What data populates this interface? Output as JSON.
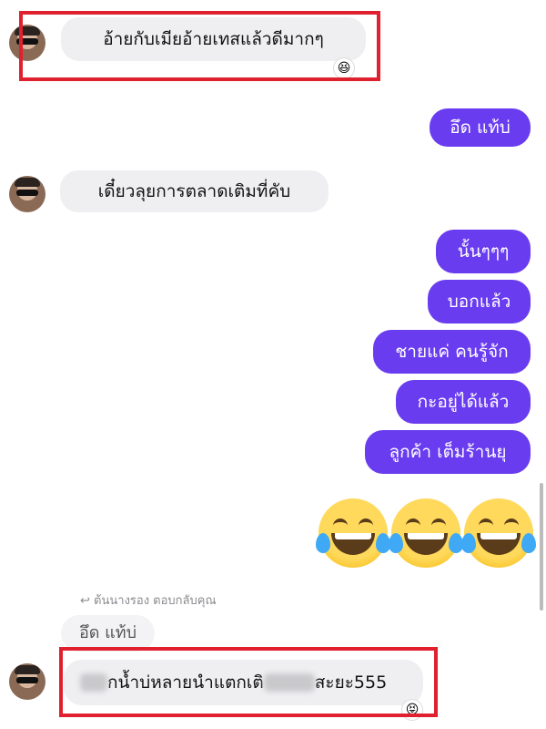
{
  "messages": {
    "m1": "อ้ายกับเมียอ้ายเทสแล้วดีมากๆ",
    "m2": "อึด แท้บ่",
    "m3": "เดี๋ยวลุยการตลาดเติมที่คับ",
    "m4": "นั้นๆๆๆ",
    "m5": "บอกแล้ว",
    "m6": "ชายแค่ คนรู้จัก",
    "m7": "กะอยู่ได้แล้ว",
    "m8": "ลูกค้า เต็มร้านยุ",
    "m9_prefix": "กน้ำบ่หลายนำแตกเติ",
    "m9_suffix": "สะยะ555"
  },
  "reply": {
    "note": "ต้นนางรอง ตอบกลับคุณ",
    "quoted": "อึด แท้บ่"
  },
  "reactions": {
    "r1": "😆",
    "r2": "😝"
  },
  "colors": {
    "outgoing_bubble": "#6a3cf0",
    "incoming_bubble": "#efeff2",
    "highlight_border": "#e0202e"
  }
}
